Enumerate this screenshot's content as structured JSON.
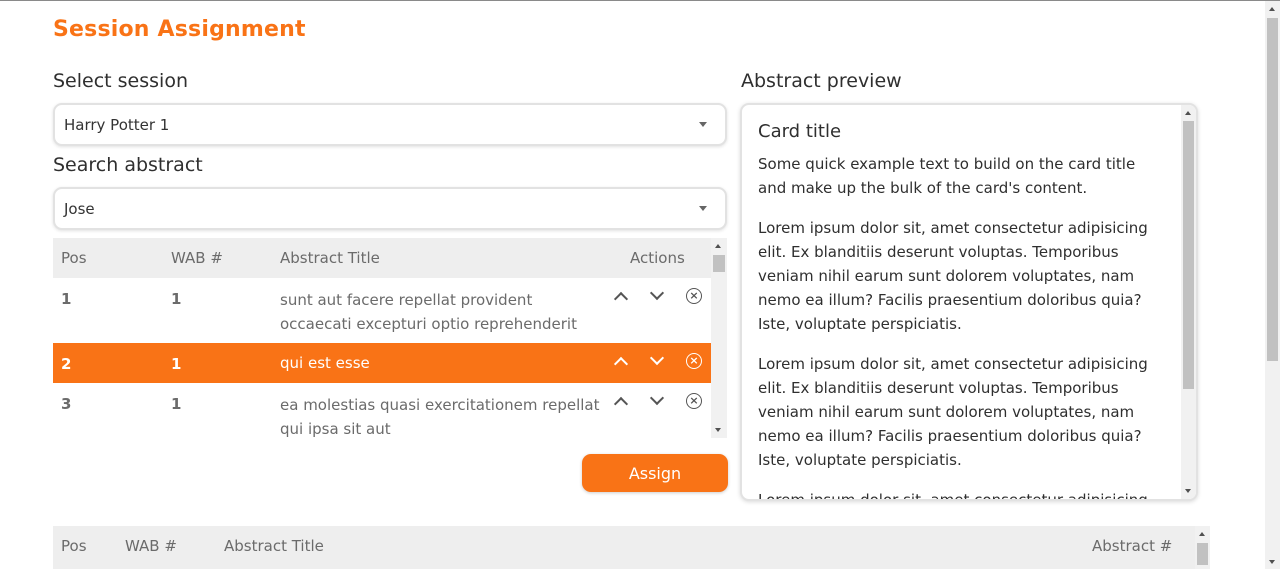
{
  "page": {
    "title": "Session Assignment"
  },
  "session": {
    "label": "Select session",
    "value": "Harry Potter 1"
  },
  "search": {
    "label": "Search abstract",
    "value": "Jose"
  },
  "table": {
    "headers": {
      "pos": "Pos",
      "wab": "WAB #",
      "title": "Abstract Title",
      "actions": "Actions"
    },
    "rows": [
      {
        "pos": "1",
        "wab": "1",
        "title": "sunt aut facere repellat provident occaecati excepturi optio reprehenderit",
        "selected": false
      },
      {
        "pos": "2",
        "wab": "1",
        "title": "qui est esse",
        "selected": true
      },
      {
        "pos": "3",
        "wab": "1",
        "title": "ea molestias quasi exercitationem repellat qui ipsa sit aut",
        "selected": false
      }
    ]
  },
  "assign_button": {
    "label": "Assign"
  },
  "preview": {
    "label": "Abstract preview",
    "card_title": "Card title",
    "paragraphs": [
      "Some quick example text to build on the card title and make up the bulk of the card's content.",
      "Lorem ipsum dolor sit, amet consectetur adipisicing elit. Ex blanditiis deserunt voluptas. Temporibus veniam nihil earum sunt dolorem voluptates, nam nemo ea illum? Facilis praesentium doloribus quia? Iste, voluptate perspiciatis.",
      "Lorem ipsum dolor sit, amet consectetur adipisicing elit. Ex blanditiis deserunt voluptas. Temporibus veniam nihil earum sunt dolorem voluptates, nam nemo ea illum? Facilis praesentium doloribus quia? Iste, voluptate perspiciatis.",
      "Lorem ipsum dolor sit, amet consectetur adipisicing elit."
    ]
  },
  "assigned_table": {
    "headers": {
      "pos": "Pos",
      "wab": "WAB #",
      "title": "Abstract Title",
      "abstract_no": "Abstract #"
    }
  },
  "colors": {
    "accent": "#f97316",
    "header_bg": "#eeeeee",
    "text": "#3a3a3a"
  },
  "icons": {
    "move_up": "chevron-up-icon",
    "move_down": "chevron-down-icon",
    "remove": "close-circle-icon",
    "dropdown": "caret-down-icon"
  }
}
